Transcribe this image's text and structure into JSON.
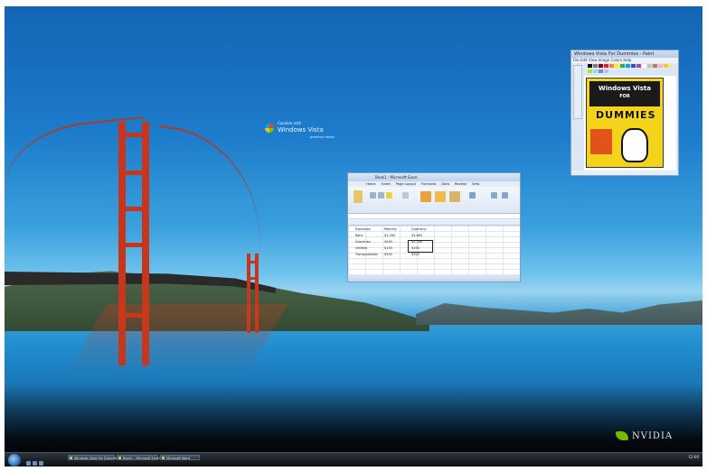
{
  "desktop": {
    "wallpaper": "golden-gate-bridge",
    "vista_logo": {
      "line1": "Capable with",
      "line2": "Windows Vista",
      "line3": "premium ready"
    },
    "brand": {
      "name": "NVIDIA",
      "accent": "#76b900"
    }
  },
  "paint_window": {
    "title": "Windows Vista For Dummies - Paint",
    "menu": "File  Edit  View  Image  Colors  Help",
    "book_title_line1": "Windows Vista",
    "book_title_line2": "FOR",
    "book_title_big": "DUMMIES",
    "palette": [
      "#000000",
      "#7f7f7f",
      "#880015",
      "#ed1c24",
      "#ff7f27",
      "#fff200",
      "#22b14c",
      "#00a2e8",
      "#3f48cc",
      "#a349a4",
      "#ffffff",
      "#c3c3c3",
      "#b97a57",
      "#ffaec9",
      "#ffc90e",
      "#efe4b0",
      "#b5e61d",
      "#99d9ea",
      "#7092be",
      "#c8bfe7"
    ]
  },
  "excel_window": {
    "title": "Book1 - Microsoft Excel",
    "tabs": [
      "Home",
      "Insert",
      "Page Layout",
      "Formulas",
      "Data",
      "Review",
      "View"
    ],
    "cells": [
      {
        "text": "Expenses"
      },
      {
        "text": "Monthly"
      },
      {
        "text": "Quarterly"
      },
      {
        "text": "Rent"
      },
      {
        "text": "$1,200"
      },
      {
        "text": "$3,600"
      },
      {
        "text": "Groceries"
      },
      {
        "text": "$450"
      },
      {
        "text": "$1,350"
      },
      {
        "text": "Utilities"
      },
      {
        "text": "$150"
      },
      {
        "text": "$450"
      },
      {
        "text": "Transportation"
      },
      {
        "text": "$300"
      },
      {
        "text": "$900"
      }
    ]
  },
  "taskbar": {
    "items": [
      "Windows Vista For Dummies...",
      "Book1 - Microsoft Excel",
      "Microsoft Word"
    ],
    "clock": "12:00"
  }
}
